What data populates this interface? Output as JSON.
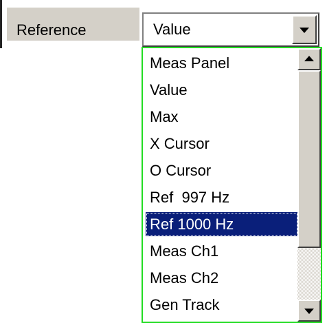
{
  "parameter": {
    "label": "Reference",
    "value": "Value"
  },
  "dropdown": {
    "items": [
      "Meas Panel",
      "Value",
      "Max",
      "X Cursor",
      "O Cursor",
      "Ref  997 Hz",
      "Ref 1000 Hz",
      "Meas Ch1",
      "Meas Ch2",
      "Gen Track"
    ],
    "selected": "Ref 1000 Hz"
  },
  "icons": {
    "combo_button": "chevron-down-icon",
    "scroll_up": "arrow-up-icon",
    "scroll_down": "arrow-down-icon"
  },
  "colors": {
    "selection_bg": "#0a1f7a",
    "dropdown_border": "#22dd22",
    "panel_gray": "#d4d0c8"
  }
}
